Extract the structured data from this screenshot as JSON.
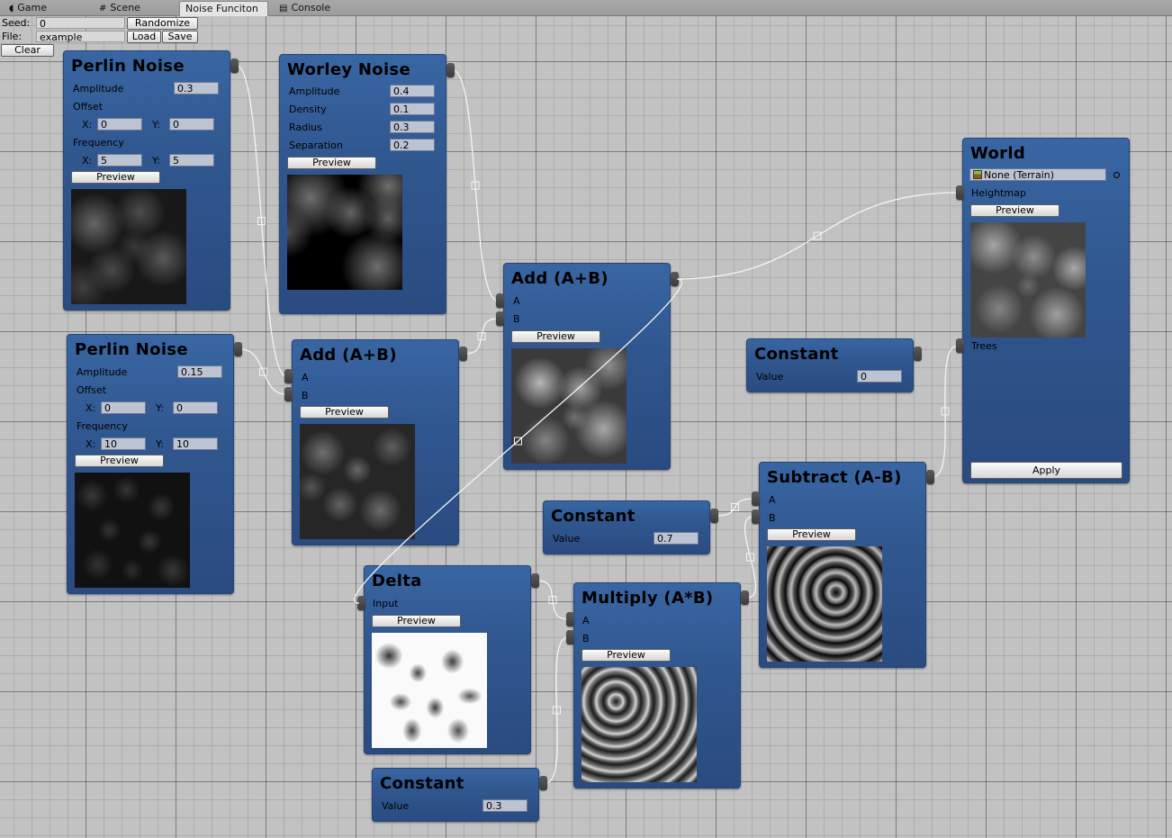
{
  "tabs": [
    {
      "label": "Game",
      "icon": "pacman-icon",
      "active": false
    },
    {
      "label": "Scene",
      "icon": "grid-icon",
      "active": false
    },
    {
      "label": "Noise Funciton",
      "icon": "",
      "active": true
    },
    {
      "label": "Console",
      "icon": "console-icon",
      "active": false
    }
  ],
  "toolbar": {
    "seed_label": "Seed:",
    "seed_value": "0",
    "randomize_label": "Randomize",
    "file_label": "File:",
    "file_value": "example",
    "load_label": "Load",
    "save_label": "Save",
    "clear_label": "Clear"
  },
  "nodes": {
    "perlin1": {
      "title": "Perlin Noise",
      "amplitude_label": "Amplitude",
      "amplitude": "0.3",
      "offset_label": "Offset",
      "offset_x_label": "X:",
      "offset_x": "0",
      "offset_y_label": "Y:",
      "offset_y": "0",
      "frequency_label": "Frequency",
      "freq_x_label": "X:",
      "freq_x": "5",
      "freq_y_label": "Y:",
      "freq_y": "5",
      "preview_label": "Preview"
    },
    "worley": {
      "title": "Worley Noise",
      "amplitude_label": "Amplitude",
      "amplitude": "0.4",
      "density_label": "Density",
      "density": "0.1",
      "radius_label": "Radius",
      "radius": "0.3",
      "separation_label": "Separation",
      "separation": "0.2",
      "preview_label": "Preview"
    },
    "perlin2": {
      "title": "Perlin Noise",
      "amplitude_label": "Amplitude",
      "amplitude": "0.15",
      "offset_label": "Offset",
      "offset_x_label": "X:",
      "offset_x": "0",
      "offset_y_label": "Y:",
      "offset_y": "0",
      "frequency_label": "Frequency",
      "freq_x_label": "X:",
      "freq_x": "10",
      "freq_y_label": "Y:",
      "freq_y": "10",
      "preview_label": "Preview"
    },
    "add1": {
      "title": "Add (A+B)",
      "a_label": "A",
      "b_label": "B",
      "preview_label": "Preview"
    },
    "add2": {
      "title": "Add (A+B)",
      "a_label": "A",
      "b_label": "B",
      "preview_label": "Preview"
    },
    "world": {
      "title": "World",
      "terrain_value": "None (Terrain)",
      "heightmap_label": "Heightmap",
      "preview_label": "Preview",
      "trees_label": "Trees",
      "apply_label": "Apply"
    },
    "constant0": {
      "title": "Constant",
      "value_label": "Value",
      "value": "0"
    },
    "constant07": {
      "title": "Constant",
      "value_label": "Value",
      "value": "0.7"
    },
    "constant03": {
      "title": "Constant",
      "value_label": "Value",
      "value": "0.3"
    },
    "subtract": {
      "title": "Subtract (A-B)",
      "a_label": "A",
      "b_label": "B",
      "preview_label": "Preview"
    },
    "delta": {
      "title": "Delta",
      "input_label": "Input",
      "preview_label": "Preview"
    },
    "multiply": {
      "title": "Multiply (A*B)",
      "a_label": "A",
      "b_label": "B",
      "preview_label": "Preview"
    }
  },
  "connections": [
    {
      "from": "perlin1.out",
      "to": "add1.a"
    },
    {
      "from": "perlin2.out",
      "to": "add1.b"
    },
    {
      "from": "worley.out",
      "to": "add2.a"
    },
    {
      "from": "add1.out",
      "to": "add2.b"
    },
    {
      "from": "add2.out",
      "to": "world.heightmap"
    },
    {
      "from": "add2.out",
      "to": "delta.input"
    },
    {
      "from": "delta.out",
      "to": "multiply.a"
    },
    {
      "from": "constant03.out",
      "to": "multiply.b"
    },
    {
      "from": "constant07.out",
      "to": "subtract.a"
    },
    {
      "from": "multiply.out",
      "to": "subtract.b"
    },
    {
      "from": "subtract.out",
      "to": "world.trees"
    }
  ],
  "colors": {
    "node_top": "#3966a3",
    "node_bottom": "#2a4b80",
    "canvas_bg": "#c2c2c2",
    "wire": "#f4f4f4"
  }
}
